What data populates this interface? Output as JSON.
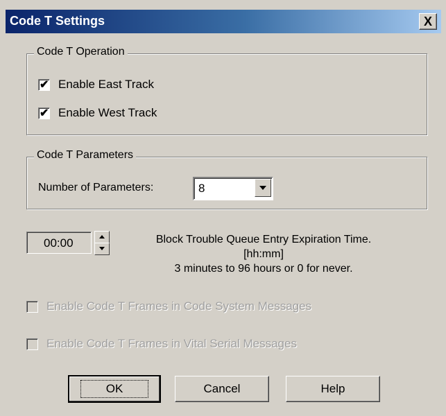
{
  "window": {
    "title": "Code T Settings",
    "close_label": "X"
  },
  "operation": {
    "legend": "Code T Operation",
    "east_label": "Enable East Track",
    "east_checked": true,
    "west_label": "Enable West Track",
    "west_checked": true,
    "check_glyph": "✔"
  },
  "parameters": {
    "legend": "Code T Parameters",
    "count_label": "Number of Parameters:",
    "count_value": "8"
  },
  "expiration": {
    "value": "00:00",
    "line1": "Block Trouble Queue Entry Expiration Time.",
    "line2": "[hh:mm]",
    "line3": "3 minutes to 96 hours or 0 for never."
  },
  "options": {
    "code_system_label": "Enable Code T Frames in Code System Messages",
    "vital_serial_label": "Enable Code T Frames in Vital Serial Messages"
  },
  "buttons": {
    "ok": "OK",
    "cancel": "Cancel",
    "help": "Help"
  }
}
